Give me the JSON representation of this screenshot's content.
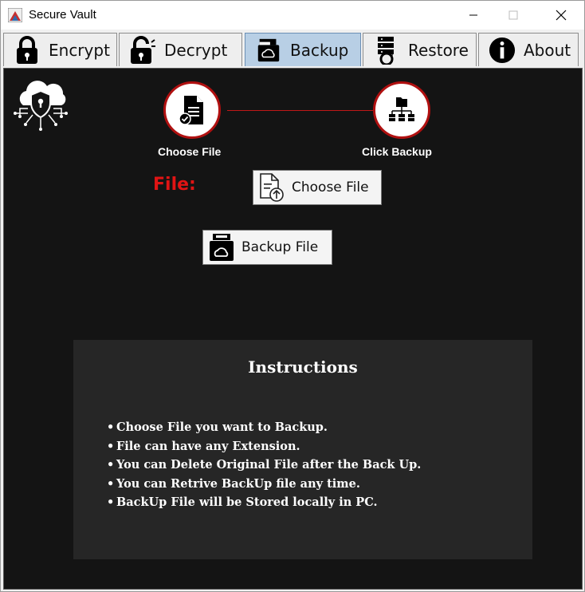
{
  "window": {
    "title": "Secure Vault",
    "app_icon": "java-app-icon",
    "controls": [
      "minimize-icon",
      "maximize-icon",
      "close-icon"
    ]
  },
  "tabs": [
    {
      "label": "Encrypt",
      "icon": "lock-icon",
      "active": false
    },
    {
      "label": "Decrypt",
      "icon": "unlock-icon",
      "active": false
    },
    {
      "label": "Backup",
      "icon": "backup-icon",
      "active": true
    },
    {
      "label": "Restore",
      "icon": "restore-icon",
      "active": false
    },
    {
      "label": "About",
      "icon": "info-icon",
      "active": false
    }
  ],
  "backup": {
    "logo_icon": "cloud-security-shield-icon",
    "steps": [
      {
        "label": "Choose File",
        "icon": "document-check-icon"
      },
      {
        "label": "Click Backup",
        "icon": "server-network-icon"
      }
    ],
    "file_label": "File:",
    "choose_button": {
      "label": "Choose File",
      "icon": "file-upload-icon"
    },
    "backup_button": {
      "label": "Backup File",
      "icon": "cloud-drive-icon"
    }
  },
  "instructions": {
    "title": "Instructions",
    "items": [
      "Choose File you want to Backup.",
      "File can have any Extension.",
      "You can Delete Original File after the Back Up.",
      "You can Retrive BackUp file any time.",
      "BackUp File will be Stored locally in PC."
    ]
  },
  "colors": {
    "panel_bg": "#141414",
    "instructions_bg": "#262626",
    "accent_red": "#e01414",
    "active_tab": "#b8cfe5"
  }
}
